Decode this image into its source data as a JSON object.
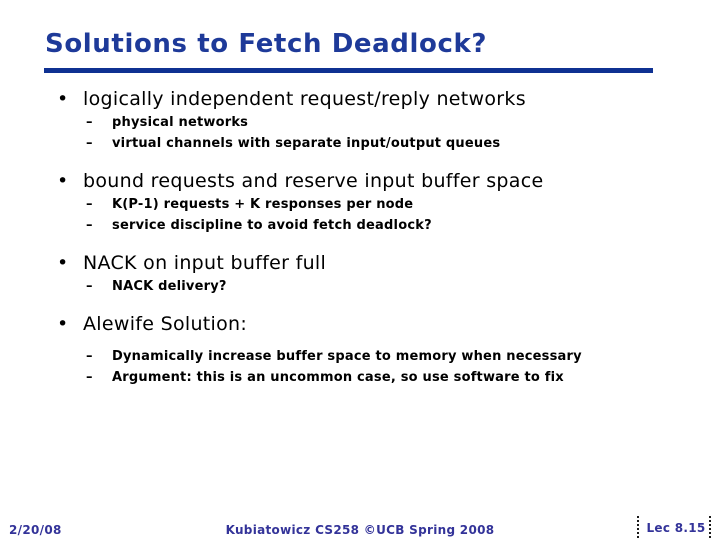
{
  "slide": {
    "title": "Solutions to Fetch Deadlock?",
    "title_color": "#1e3a99",
    "rule_color": "#0f3192",
    "background_color": "#ffffff",
    "body_color": "#000000",
    "bullet_marker": "•",
    "sub_bullet_marker": "–",
    "groups": [
      {
        "heading": "logically independent request/reply networks",
        "subitems": [
          "physical networks",
          "virtual channels with separate input/output queues"
        ]
      },
      {
        "heading": "bound requests and reserve input buffer space",
        "subitems": [
          "K(P-1) requests + K responses per node",
          "service discipline to avoid fetch deadlock?"
        ]
      },
      {
        "heading": "NACK on input buffer full",
        "subitems": [
          "NACK delivery?"
        ]
      },
      {
        "heading": "Alewife Solution:",
        "subitems": [
          "Dynamically increase buffer space to memory when necessary",
          "Argument: this is an uncommon case, so use software to fix"
        ]
      }
    ]
  },
  "footer": {
    "date": "2/20/08",
    "center": "Kubiatowicz CS258 ©UCB Spring 2008",
    "page": "Lec 8.15",
    "text_color": "#333399"
  }
}
